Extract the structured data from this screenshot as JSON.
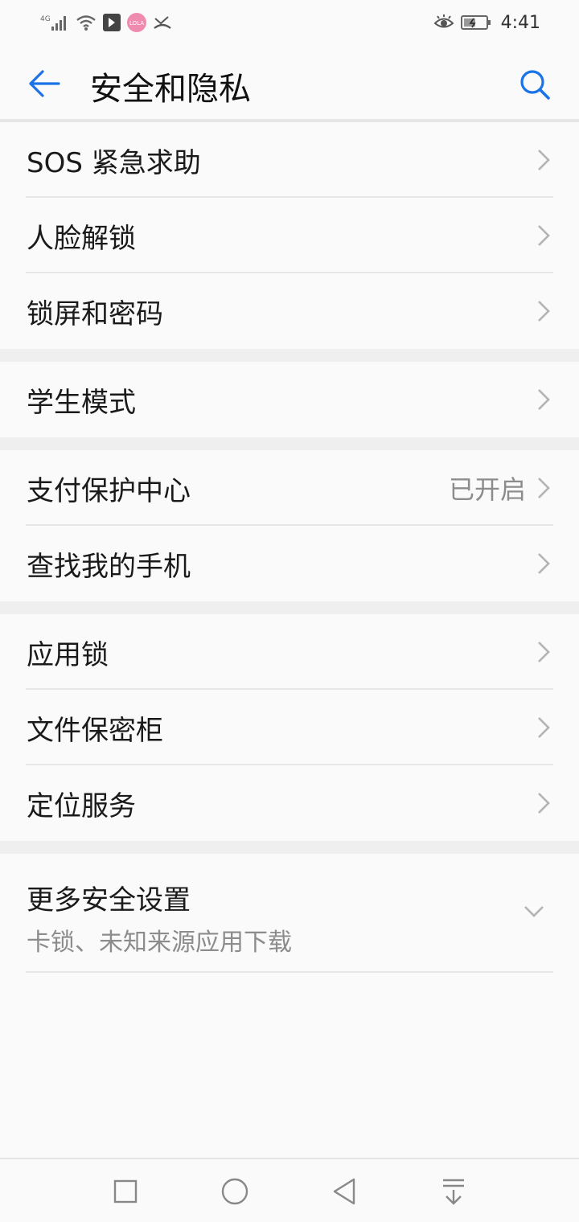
{
  "status_bar": {
    "network_label": "4G",
    "time": "4:41",
    "app_badge": "LOLA"
  },
  "header": {
    "title": "安全和隐私"
  },
  "groups": [
    {
      "items": [
        {
          "label": "SOS 紧急求助"
        },
        {
          "label": "人脸解锁"
        },
        {
          "label": "锁屏和密码"
        }
      ]
    },
    {
      "items": [
        {
          "label": "学生模式"
        }
      ]
    },
    {
      "items": [
        {
          "label": "支付保护中心",
          "value": "已开启"
        },
        {
          "label": "查找我的手机"
        }
      ]
    },
    {
      "items": [
        {
          "label": "应用锁"
        },
        {
          "label": "文件保密柜"
        },
        {
          "label": "定位服务"
        }
      ]
    }
  ],
  "more": {
    "title": "更多安全设置",
    "subtitle": "卡锁、未知来源应用下载"
  },
  "colors": {
    "accent": "#1a73e8",
    "background": "#fafafa",
    "separator": "#efefef"
  }
}
